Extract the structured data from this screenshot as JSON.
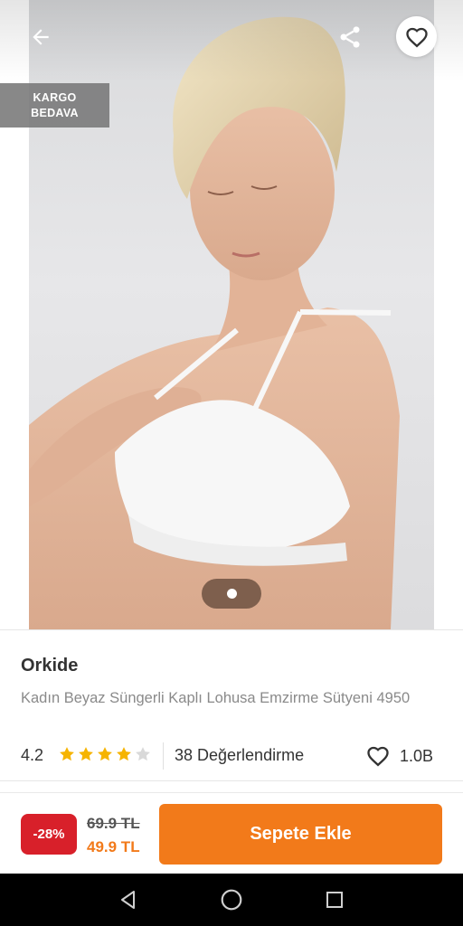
{
  "header": {
    "back_icon": "arrow-left-icon",
    "share_icon": "share-icon",
    "favorite_icon": "heart-outline-icon"
  },
  "badge": {
    "line1": "KARGO",
    "line2": "BEDAVA"
  },
  "gallery": {
    "current_page": 1,
    "total_pages": 1
  },
  "product": {
    "brand": "Orkide",
    "title": "Kadın Beyaz Süngerli Kaplı Lohusa Emzirme Sütyeni 4950",
    "rating": "4.2",
    "rating_value": 4.2,
    "stars_total": 5,
    "review_count": "38 Değerlendirme",
    "like_count": "1.0B"
  },
  "purchase": {
    "discount": "-28%",
    "old_price": "69.9 TL",
    "new_price": "49.9 TL",
    "add_to_cart_label": "Sepete Ekle"
  },
  "system_nav": {
    "back_icon": "triangle-back-icon",
    "home_icon": "circle-home-icon",
    "recents_icon": "square-recents-icon"
  },
  "colors": {
    "accent": "#f27a1a",
    "discount": "#d8202a",
    "star": "#f6b400"
  }
}
